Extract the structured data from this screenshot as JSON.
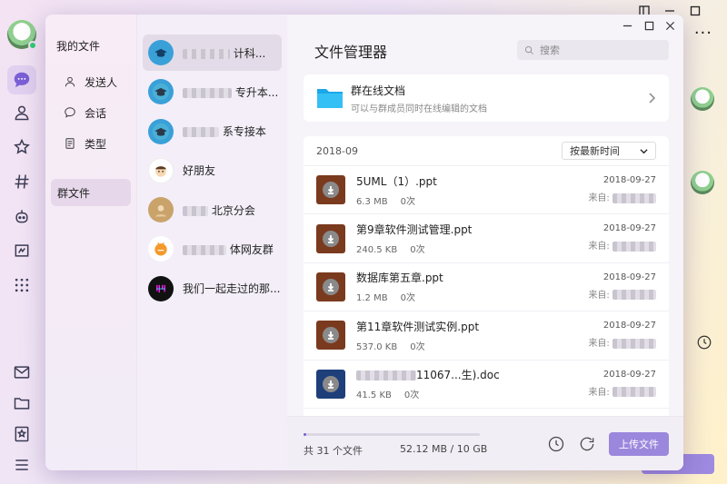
{
  "dialog": {
    "title": "文件管理器",
    "search_placeholder": "搜索"
  },
  "nav": {
    "title": "我的文件",
    "items": [
      {
        "label": "发送人",
        "icon": "person-icon"
      },
      {
        "label": "会话",
        "icon": "chat-bubble-icon"
      },
      {
        "label": "类型",
        "icon": "document-type-icon"
      }
    ],
    "group_files_label": "群文件"
  },
  "groups": [
    {
      "name_visible": "计科...",
      "avatar": "blue-graduation-cap"
    },
    {
      "name_visible": "专升本...",
      "avatar": "blue-graduation-cap"
    },
    {
      "name_visible": "系专接本",
      "avatar": "blue-graduation-cap"
    },
    {
      "name_visible": "好朋友",
      "avatar": "cartoon-face"
    },
    {
      "name_visible": "北京分会",
      "avatar": "person-photo"
    },
    {
      "name_visible": "体网友群",
      "avatar": "orange-mascot"
    },
    {
      "name_visible": "我们一起走过的那...",
      "avatar": "dark-logo"
    }
  ],
  "online_docs": {
    "title": "群在线文档",
    "subtitle": "可以与群成员同时在线编辑的文档"
  },
  "file_list": {
    "date_header": "2018-09",
    "sort_label": "按最新时间",
    "files": [
      {
        "name": "5UML（1）.ppt",
        "size": "6.3 MB",
        "downloads": "0次",
        "date": "2018-09-27",
        "from": "来自:",
        "type": "ppt"
      },
      {
        "name": "第9章软件测试管理.ppt",
        "size": "240.5 KB",
        "downloads": "0次",
        "date": "2018-09-27",
        "from": "来自:",
        "type": "ppt"
      },
      {
        "name": "数据库第五章.ppt",
        "size": "1.2 MB",
        "downloads": "0次",
        "date": "2018-09-27",
        "from": "来自:",
        "type": "ppt"
      },
      {
        "name": "第11章软件测试实例.ppt",
        "size": "537.0 KB",
        "downloads": "0次",
        "date": "2018-09-27",
        "from": "来自:",
        "type": "ppt"
      },
      {
        "name": "11067...生).doc",
        "size": "41.5 KB",
        "downloads": "0次",
        "date": "2018-09-27",
        "from": "来自:",
        "type": "doc"
      }
    ]
  },
  "footer": {
    "file_count": "共 31 个文件",
    "storage": "52.12 MB / 10 GB",
    "storage_used_fraction": 0.005,
    "upload_label": "上传文件"
  },
  "colors": {
    "accent": "#7b5fd6",
    "upload_button": "#9b87dc",
    "ppt_icon": "#7a3a1e",
    "doc_icon": "#1e3f7a"
  }
}
